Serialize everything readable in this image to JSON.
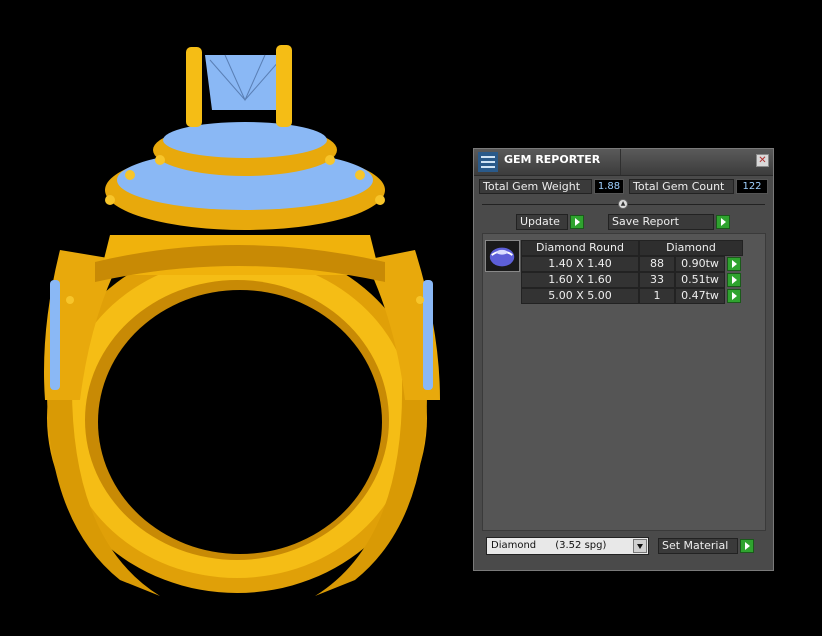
{
  "window": {
    "title": "GEM REPORTER"
  },
  "summary": {
    "total_weight_label": "Total Gem Weight",
    "total_weight_value": "1.88",
    "total_count_label": "Total Gem Count",
    "total_count_value": "122"
  },
  "buttons": {
    "update": "Update",
    "save_report": "Save Report",
    "set_material": "Set Material"
  },
  "table": {
    "headers": [
      "Diamond Round",
      "Diamond"
    ],
    "rows": [
      {
        "size": "1.40 X 1.40",
        "count": "88",
        "weight": "0.90tw"
      },
      {
        "size": "1.60 X 1.60",
        "count": "33",
        "weight": "0.51tw"
      },
      {
        "size": "5.00 X 5.00",
        "count": "1",
        "weight": "0.47tw"
      }
    ]
  },
  "material_select": {
    "value": "Diamond      (3.52 spg)"
  },
  "colors": {
    "metal": "#f2b50a",
    "gem": "#8ab8f5",
    "accent_go": "#2fa32f",
    "value_text": "#9fd0ff"
  },
  "icons": [
    "gem-reporter-icon",
    "close-icon",
    "collapse-icon",
    "go-arrow-icon",
    "round-gem-icon",
    "dropdown-arrow-icon"
  ]
}
